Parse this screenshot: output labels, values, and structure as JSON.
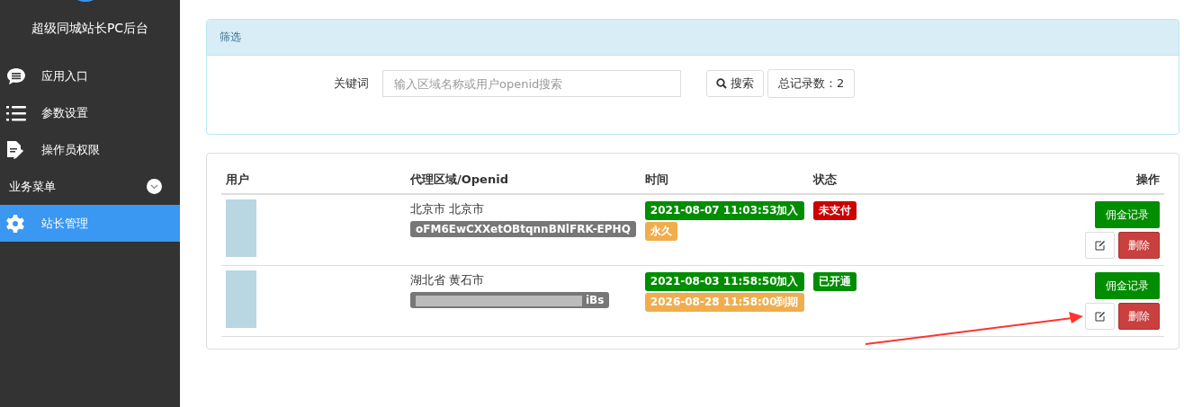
{
  "sidebar": {
    "title": "超级同城站长PC后台",
    "items": [
      {
        "kind": "link",
        "label": "应用入口",
        "selected": false
      },
      {
        "kind": "link",
        "label": "参数设置",
        "selected": false
      },
      {
        "kind": "link",
        "label": "操作员权限",
        "selected": false
      },
      {
        "kind": "group",
        "label": "业务菜单",
        "expanded": true
      },
      {
        "kind": "link",
        "label": "站长管理",
        "selected": true
      }
    ]
  },
  "filter": {
    "title": "筛选",
    "keyword_label": "关键词",
    "search": {
      "placeholder": "输入区域名称或用户openid搜索"
    },
    "search_button": "搜索",
    "total": "总记录数：2"
  },
  "table": {
    "columns": [
      "用户",
      "代理区域/Openid",
      "时间",
      "状态",
      "操作"
    ],
    "rows": [
      {
        "region": "北京市 北京市",
        "openid": "oFM6EwCXXetOBtqnnBNlFRK-EPHQ",
        "openid_redacted": false,
        "times": [
          {
            "text": "2021-08-07 11:03:53加入",
            "color": "#008d00"
          },
          {
            "text": "永久",
            "color": "#f0ad4e"
          }
        ],
        "status": {
          "text": "未支付",
          "color": "#cc0000"
        },
        "commission_button": "佣金记录",
        "delete_button": "删除"
      },
      {
        "region": "湖北省 黄石市",
        "openid": "iBs",
        "openid_redacted": true,
        "times": [
          {
            "text": "2021-08-03 11:58:50加入",
            "color": "#008d00"
          },
          {
            "text": "2026-08-28 11:58:00到期",
            "color": "#f0ad4e"
          }
        ],
        "status": {
          "text": "已开通",
          "color": "#008d00"
        },
        "commission_button": "佣金记录",
        "delete_button": "删除"
      }
    ]
  }
}
